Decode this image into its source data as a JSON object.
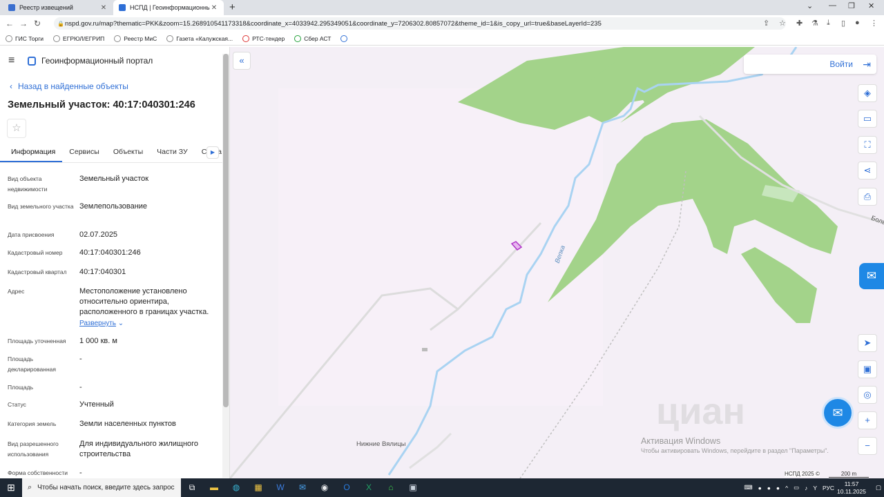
{
  "browser": {
    "tabs": [
      {
        "title": "Реестр извещений",
        "active": false
      },
      {
        "title": "НСПД | Геоинформационный п",
        "active": true
      }
    ],
    "url": "nspd.gov.ru/map?thematic=PKK&zoom=15.268910541173318&coordinate_x=4033942.295349051&coordinate_y=7206302.80857072&theme_id=1&is_copy_url=true&baseLayerId=235",
    "bookmarks": [
      "ГИС Торги",
      "ЕГРЮЛ/ЕГРИП",
      "Реестр МиС",
      "Газета «Калужская...",
      "РТС-тендер",
      "Сбер АСТ"
    ]
  },
  "panel": {
    "portal_name": "Геоинформационный портал",
    "back_link": "Назад в найденные объекты",
    "title": "Земельный участок: 40:17:040301:246",
    "tabs": [
      "Информация",
      "Сервисы",
      "Объекты",
      "Части ЗУ",
      "Соста"
    ],
    "attributes": [
      {
        "label": "Вид объекта недвижимости",
        "value": "Земельный участок"
      },
      {
        "label": "Вид земельного участка",
        "value": "Землепользование"
      },
      {
        "label": "Дата присвоения",
        "value": "02.07.2025"
      },
      {
        "label": "Кадастровый номер",
        "value": "40:17:040301:246"
      },
      {
        "label": "Кадастровый квартал",
        "value": "40:17:040301"
      },
      {
        "label": "Адрес",
        "value": "Местоположение установлено относительно ориентира, расположенного в границах участка."
      },
      {
        "label": "Площадь уточненная",
        "value": "1 000 кв. м"
      },
      {
        "label": "Площадь декларированная",
        "value": "-"
      },
      {
        "label": "Площадь",
        "value": "-"
      },
      {
        "label": "Статус",
        "value": "Учтенный"
      },
      {
        "label": "Категория земель",
        "value": "Земли населенных пунктов"
      },
      {
        "label": "Вид разрешенного использования",
        "value": "Для индивидуального жилищного строительства"
      },
      {
        "label": "Форма собственности",
        "value": "-"
      }
    ],
    "expand_label": "Развернуть"
  },
  "map": {
    "login_label": "Войти",
    "labels": {
      "village": "Нижние Вялицы",
      "river": "Вепка",
      "road": "Боль"
    },
    "copyright": "НСПД 2025 ©",
    "scale": "200 m",
    "watermark_logo": "циан",
    "activation_title": "Активация Windows",
    "activation_text": "Чтобы активировать Windows, перейдите в раздел \"Параметры\".",
    "colors": {
      "forest": "#a3d38a",
      "water": "#a9d3f2",
      "background": "#f4eff6",
      "parcel": "#b033c8"
    }
  },
  "taskbar": {
    "search_placeholder": "Чтобы начать поиск, введите здесь запрос",
    "lang": "РУС",
    "time": "11:57",
    "date": "10.11.2025"
  }
}
